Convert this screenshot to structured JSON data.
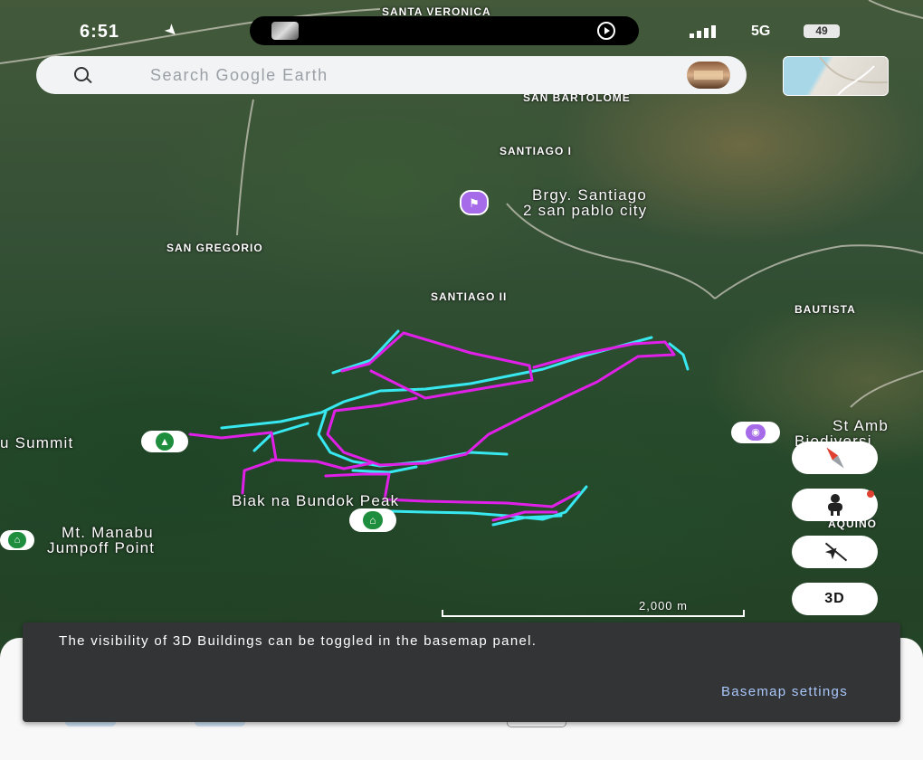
{
  "status_bar": {
    "time": "6:51",
    "network": "5G",
    "battery": "49"
  },
  "search": {
    "placeholder": "Search Google Earth"
  },
  "map": {
    "places": {
      "santa_veronica": "SANTA VERONICA",
      "san_bartolome": "SAN BARTOLOME",
      "santiago_i": "SANTIAGO I",
      "brgy_santiago_line1": "Brgy. Santiago",
      "brgy_santiago_line2": "2 san pablo city",
      "san_gregorio": "SAN GREGORIO",
      "santiago_ii": "SANTIAGO II",
      "bautista": "BAUTISTA",
      "summit": "u Summit",
      "st_amb_line1": "St Amb",
      "st_amb_line2": "Biodiversi",
      "biak": "Biak na Bundok Peak",
      "manabu_line1": "Mt. Manabu",
      "manabu_line2": "Jumpoff Point",
      "aquino": "AQUINO"
    },
    "scale": "2,000 m",
    "track_colors": {
      "primary": "#e020e8",
      "secondary": "#38e8f0"
    }
  },
  "controls": {
    "compass_icon": "compass-icon",
    "street_view_icon": "pegman-icon",
    "location_icon": "location-off-icon",
    "view_3d": "3D"
  },
  "toast": {
    "message": "The visibility of 3D Buildings can be toggled in the basemap panel.",
    "action": "Basemap settings"
  }
}
